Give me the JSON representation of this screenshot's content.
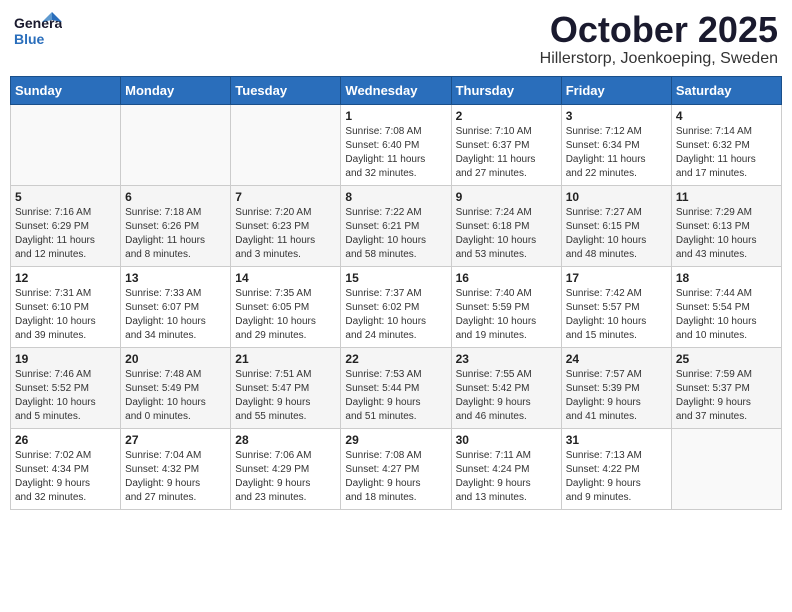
{
  "header": {
    "logo_general": "General",
    "logo_blue": "Blue",
    "month": "October 2025",
    "location": "Hillerstorp, Joenkoeping, Sweden"
  },
  "weekdays": [
    "Sunday",
    "Monday",
    "Tuesday",
    "Wednesday",
    "Thursday",
    "Friday",
    "Saturday"
  ],
  "rows": [
    [
      {
        "day": "",
        "info": ""
      },
      {
        "day": "",
        "info": ""
      },
      {
        "day": "",
        "info": ""
      },
      {
        "day": "1",
        "info": "Sunrise: 7:08 AM\nSunset: 6:40 PM\nDaylight: 11 hours\nand 32 minutes."
      },
      {
        "day": "2",
        "info": "Sunrise: 7:10 AM\nSunset: 6:37 PM\nDaylight: 11 hours\nand 27 minutes."
      },
      {
        "day": "3",
        "info": "Sunrise: 7:12 AM\nSunset: 6:34 PM\nDaylight: 11 hours\nand 22 minutes."
      },
      {
        "day": "4",
        "info": "Sunrise: 7:14 AM\nSunset: 6:32 PM\nDaylight: 11 hours\nand 17 minutes."
      }
    ],
    [
      {
        "day": "5",
        "info": "Sunrise: 7:16 AM\nSunset: 6:29 PM\nDaylight: 11 hours\nand 12 minutes."
      },
      {
        "day": "6",
        "info": "Sunrise: 7:18 AM\nSunset: 6:26 PM\nDaylight: 11 hours\nand 8 minutes."
      },
      {
        "day": "7",
        "info": "Sunrise: 7:20 AM\nSunset: 6:23 PM\nDaylight: 11 hours\nand 3 minutes."
      },
      {
        "day": "8",
        "info": "Sunrise: 7:22 AM\nSunset: 6:21 PM\nDaylight: 10 hours\nand 58 minutes."
      },
      {
        "day": "9",
        "info": "Sunrise: 7:24 AM\nSunset: 6:18 PM\nDaylight: 10 hours\nand 53 minutes."
      },
      {
        "day": "10",
        "info": "Sunrise: 7:27 AM\nSunset: 6:15 PM\nDaylight: 10 hours\nand 48 minutes."
      },
      {
        "day": "11",
        "info": "Sunrise: 7:29 AM\nSunset: 6:13 PM\nDaylight: 10 hours\nand 43 minutes."
      }
    ],
    [
      {
        "day": "12",
        "info": "Sunrise: 7:31 AM\nSunset: 6:10 PM\nDaylight: 10 hours\nand 39 minutes."
      },
      {
        "day": "13",
        "info": "Sunrise: 7:33 AM\nSunset: 6:07 PM\nDaylight: 10 hours\nand 34 minutes."
      },
      {
        "day": "14",
        "info": "Sunrise: 7:35 AM\nSunset: 6:05 PM\nDaylight: 10 hours\nand 29 minutes."
      },
      {
        "day": "15",
        "info": "Sunrise: 7:37 AM\nSunset: 6:02 PM\nDaylight: 10 hours\nand 24 minutes."
      },
      {
        "day": "16",
        "info": "Sunrise: 7:40 AM\nSunset: 5:59 PM\nDaylight: 10 hours\nand 19 minutes."
      },
      {
        "day": "17",
        "info": "Sunrise: 7:42 AM\nSunset: 5:57 PM\nDaylight: 10 hours\nand 15 minutes."
      },
      {
        "day": "18",
        "info": "Sunrise: 7:44 AM\nSunset: 5:54 PM\nDaylight: 10 hours\nand 10 minutes."
      }
    ],
    [
      {
        "day": "19",
        "info": "Sunrise: 7:46 AM\nSunset: 5:52 PM\nDaylight: 10 hours\nand 5 minutes."
      },
      {
        "day": "20",
        "info": "Sunrise: 7:48 AM\nSunset: 5:49 PM\nDaylight: 10 hours\nand 0 minutes."
      },
      {
        "day": "21",
        "info": "Sunrise: 7:51 AM\nSunset: 5:47 PM\nDaylight: 9 hours\nand 55 minutes."
      },
      {
        "day": "22",
        "info": "Sunrise: 7:53 AM\nSunset: 5:44 PM\nDaylight: 9 hours\nand 51 minutes."
      },
      {
        "day": "23",
        "info": "Sunrise: 7:55 AM\nSunset: 5:42 PM\nDaylight: 9 hours\nand 46 minutes."
      },
      {
        "day": "24",
        "info": "Sunrise: 7:57 AM\nSunset: 5:39 PM\nDaylight: 9 hours\nand 41 minutes."
      },
      {
        "day": "25",
        "info": "Sunrise: 7:59 AM\nSunset: 5:37 PM\nDaylight: 9 hours\nand 37 minutes."
      }
    ],
    [
      {
        "day": "26",
        "info": "Sunrise: 7:02 AM\nSunset: 4:34 PM\nDaylight: 9 hours\nand 32 minutes."
      },
      {
        "day": "27",
        "info": "Sunrise: 7:04 AM\nSunset: 4:32 PM\nDaylight: 9 hours\nand 27 minutes."
      },
      {
        "day": "28",
        "info": "Sunrise: 7:06 AM\nSunset: 4:29 PM\nDaylight: 9 hours\nand 23 minutes."
      },
      {
        "day": "29",
        "info": "Sunrise: 7:08 AM\nSunset: 4:27 PM\nDaylight: 9 hours\nand 18 minutes."
      },
      {
        "day": "30",
        "info": "Sunrise: 7:11 AM\nSunset: 4:24 PM\nDaylight: 9 hours\nand 13 minutes."
      },
      {
        "day": "31",
        "info": "Sunrise: 7:13 AM\nSunset: 4:22 PM\nDaylight: 9 hours\nand 9 minutes."
      },
      {
        "day": "",
        "info": ""
      }
    ]
  ]
}
